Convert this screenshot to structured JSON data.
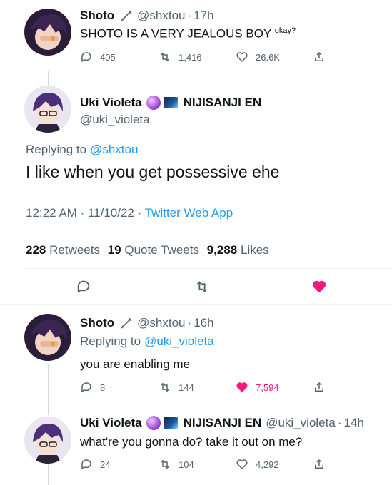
{
  "tweet1": {
    "name": "Shoto",
    "badge_icon": "sword-icon",
    "handle": "@shxtou",
    "dot": "·",
    "time": "17h",
    "text": "SHOTO IS A VERY JEALOUS BOY",
    "text_sup": "okay?",
    "replies": "405",
    "retweets": "1,416",
    "likes": "26.6K"
  },
  "main_tweet": {
    "name": "Uki Violeta",
    "handle": "@uki_violeta",
    "affiliation": "NIJISANJI EN",
    "replying_prefix": "Replying to",
    "replying_to": "@shxtou",
    "text": "I like when you get possessive ehe",
    "time": "12:22 AM",
    "dot1": "·",
    "date": "11/10/22",
    "dot2": "·",
    "source": "Twitter Web App",
    "retweets_count": "228",
    "retweets_label": "Retweets",
    "quotes_count": "19",
    "quotes_label": "Quote Tweets",
    "likes_count": "9,288",
    "likes_label": "Likes"
  },
  "reply1": {
    "name": "Shoto",
    "handle": "@shxtou",
    "dot": "·",
    "time": "16h",
    "replying_prefix": "Replying to",
    "replying_to": "@uki_violeta",
    "text": "you are enabling me",
    "replies": "8",
    "retweets": "144",
    "likes": "7,594"
  },
  "reply2": {
    "name": "Uki Violeta",
    "affiliation": "NIJISANJI EN",
    "handle": "@uki_violeta",
    "dot": "·",
    "time": "14h",
    "text": "what're you gonna do? take it out on me?",
    "replies": "24",
    "retweets": "104",
    "likes": "4,292"
  },
  "colors": {
    "accent": "#1d9bf0",
    "like": "#f91880",
    "muted": "#536471"
  }
}
